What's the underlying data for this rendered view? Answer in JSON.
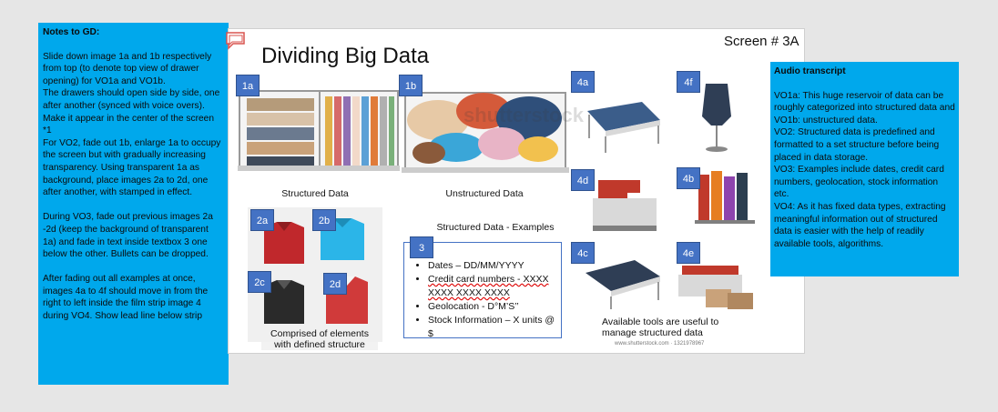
{
  "notes_panel": {
    "title": "Notes to GD:",
    "body": "Slide down image 1a and 1b respectively from top (to denote top view of drawer opening) for VO1a and VO1b.\nThe drawers should open side by side, one after another (synced with voice overs). Make it appear in the center of the screen\n*1\nFor VO2, fade out 1b, enlarge 1a to occupy the screen but with gradually increasing transparency. Using transparent 1a as background, place images 2a to 2d, one after another, with stamped in effect.\n\nDuring VO3, fade out previous images 2a -2d (keep the background of transparent 1a) and fade in text inside textbox 3 one below the other. Bullets can be dropped.\n\nAfter fading out all examples at once, images 4a to 4f should move in from the right to left inside the film strip image 4 during VO4. Show lead line below strip"
  },
  "audio_panel": {
    "title": "Audio transcript",
    "body": "VO1a: This huge reservoir of data can be roughly categorized into structured data and\nVO1b: unstructured data.\nVO2: Structured data is predefined and formatted to a set structure before being placed in data storage.\nVO3: Examples include dates, credit card numbers, geolocation, stock information etc.\nVO4: As it has fixed data types, extracting meaningful information out of structured data is easier with the help of readily available tools, algorithms."
  },
  "slide": {
    "title": "Dividing Big Data",
    "screen_label": "Screen # 3A",
    "tags": {
      "t1a": "1a",
      "t1b": "1b",
      "t2a": "2a",
      "t2b": "2b",
      "t2c": "2c",
      "t2d": "2d",
      "t3": "3",
      "t4a": "4a",
      "t4b": "4b",
      "t4c": "4c",
      "t4d": "4d",
      "t4e": "4e",
      "t4f": "4f"
    },
    "captions": {
      "structured": "Structured Data",
      "unstructured": "Unstructured Data",
      "examples_heading": "Structured Data - Examples",
      "comprised": "Comprised of elements with defined structure",
      "tools": "Available tools are useful to manage structured data"
    },
    "examples": [
      "Dates – DD/MM/YYYY",
      "Credit card numbers - XXXX XXXX XXXX XXXX",
      "Geolocation - D°M’S’’",
      "Stock Information – X units @ $"
    ],
    "watermark": "shutterstock",
    "stock_id": "www.shutterstock.com · 1321978967"
  },
  "colors": {
    "note_bg": "#00a8ec",
    "tag_bg": "#4472c4",
    "shirt_red": "#c0282c",
    "shirt_blue": "#2bb5e8",
    "shirt_black": "#2a2a2a"
  }
}
